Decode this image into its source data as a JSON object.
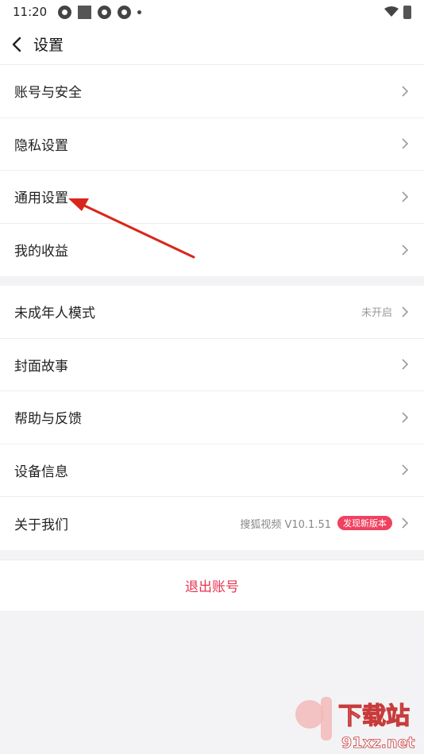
{
  "status_bar": {
    "time": "11:20"
  },
  "header": {
    "title": "设置"
  },
  "groups": [
    {
      "items": [
        {
          "label": "账号与安全"
        },
        {
          "label": "隐私设置"
        },
        {
          "label": "通用设置"
        },
        {
          "label": "我的收益"
        }
      ]
    },
    {
      "items": [
        {
          "label": "未成年人模式",
          "value": "未开启"
        },
        {
          "label": "封面故事"
        },
        {
          "label": "帮助与反馈"
        },
        {
          "label": "设备信息"
        },
        {
          "label": "关于我们",
          "version": "搜狐视频 V10.1.51",
          "badge": "发现新版本"
        }
      ]
    }
  ],
  "logout": {
    "label": "退出账号"
  },
  "watermark": {
    "text": "下载站",
    "domain": "91xz.net"
  },
  "colors": {
    "accent": "#e8334e",
    "badge": "#f0415f",
    "background": "#f3f3f5"
  }
}
